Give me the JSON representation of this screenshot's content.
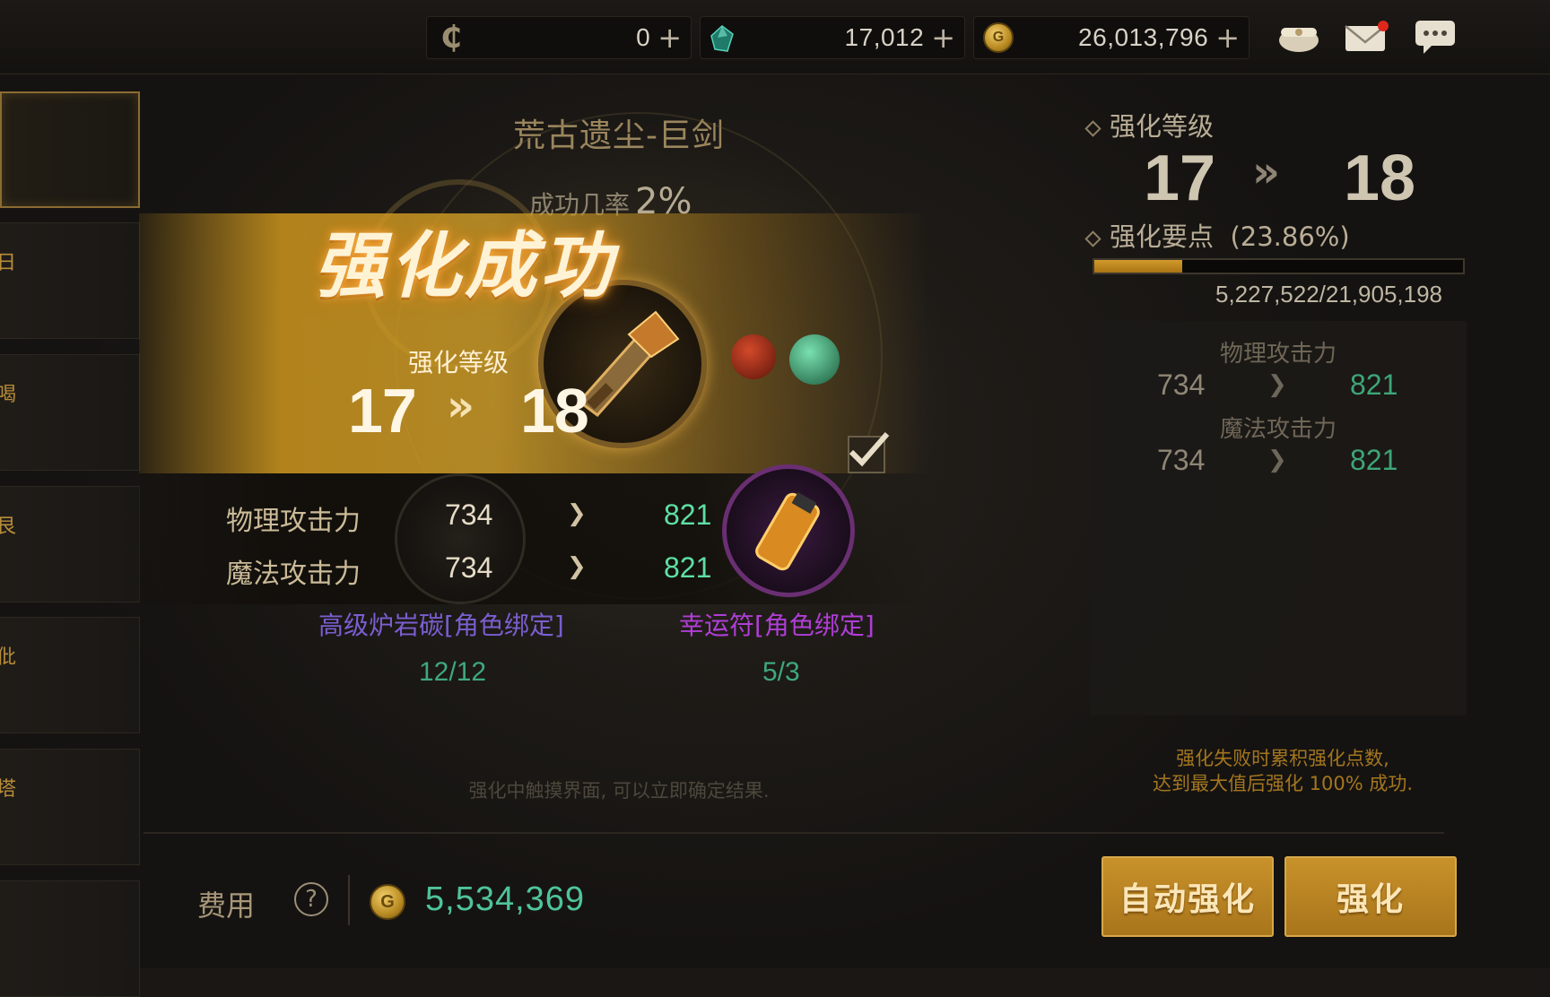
{
  "currencies": [
    {
      "icon": "cera-coin-icon",
      "value": "0",
      "plus": "+"
    },
    {
      "icon": "green-gem-icon",
      "value": "17,012",
      "plus": "+"
    },
    {
      "icon": "gold-coin-icon",
      "value": "26,013,796",
      "plus": "+"
    }
  ],
  "topbar_icons": [
    "treasure-bag-icon",
    "mail-icon",
    "chat-icon"
  ],
  "sidebar": {
    "items": [
      {
        "glyph": ""
      },
      {
        "glyph": "日"
      },
      {
        "glyph": "喝"
      },
      {
        "glyph": "艮"
      },
      {
        "glyph": "仳"
      },
      {
        "glyph": "塔"
      },
      {
        "glyph": ""
      }
    ]
  },
  "item": {
    "name": "荒古遗尘-巨剑",
    "success_rate_label": "成功几率",
    "success_rate_value": "2%"
  },
  "result": {
    "title": "强化成功",
    "level_label": "强化等级",
    "level_from": "17",
    "level_to": "18",
    "chevron": "»",
    "stats": [
      {
        "name": "物理攻击力",
        "old": "734",
        "new": "821"
      },
      {
        "name": "魔法攻击力",
        "old": "734",
        "new": "821"
      }
    ]
  },
  "materials": [
    {
      "name": "高级炉岩碳[角色绑定]",
      "count": "12/12",
      "color": "#7b5ed0"
    },
    {
      "name": "幸运符[角色绑定]",
      "count": "5/3",
      "color": "#b03ed6"
    }
  ],
  "hint_center": "强化中触摸界面, 可以立即确定结果.",
  "cost": {
    "label": "费用",
    "help": "?",
    "value": "5,534,369"
  },
  "right_panel": {
    "level_label": "强化等级",
    "level_from": "17",
    "level_to": "18",
    "points_label": "强化要点",
    "points_percent": "(23.86%)",
    "points_fraction": 0.2386,
    "points_text": "5,227,522/21,905,198",
    "stats": [
      {
        "name": "物理攻击力",
        "old": "734",
        "new": "821"
      },
      {
        "name": "魔法攻击力",
        "old": "734",
        "new": "821"
      }
    ],
    "hint_line1": "强化失败时累积强化点数,",
    "hint_line2": "达到最大值后强化 100% 成功."
  },
  "buttons": {
    "auto_enhance": "自动强化",
    "enhance": "强化"
  },
  "colors": {
    "accent_gold": "#c8912a",
    "stat_green": "#5ee0a4"
  }
}
